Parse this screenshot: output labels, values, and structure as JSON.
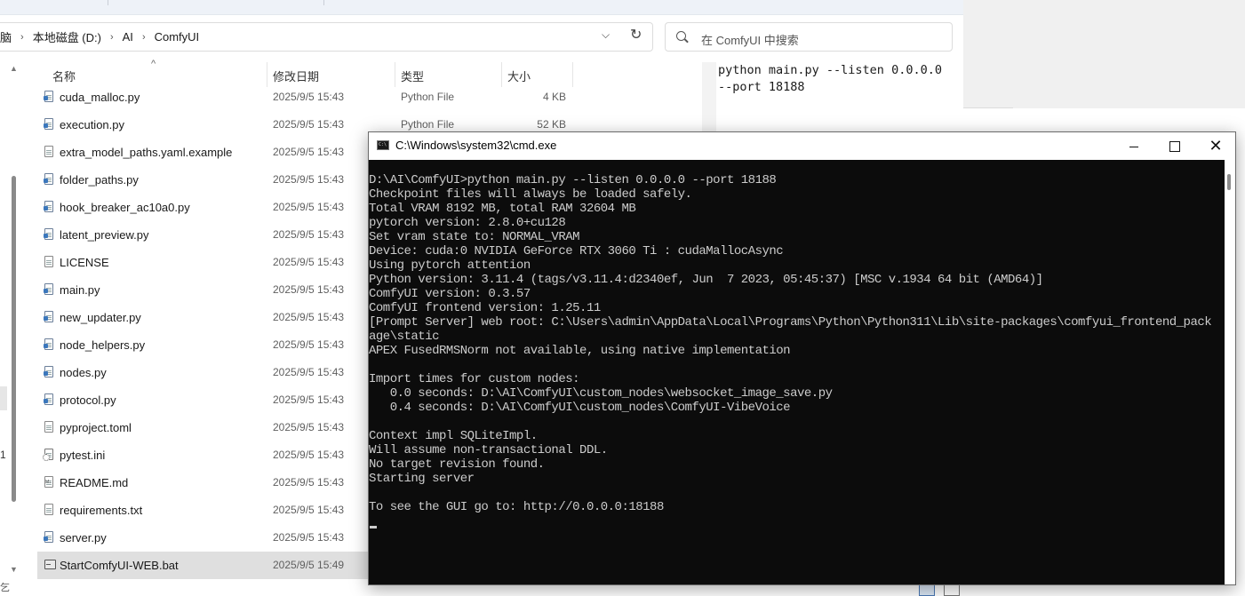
{
  "explorer": {
    "breadcrumbs": [
      "脑",
      "本地磁盘 (D:)",
      "AI",
      "ComfyUI"
    ],
    "search_placeholder": "在 ComfyUI 中搜索",
    "columns": {
      "name": "名称",
      "date": "修改日期",
      "type": "类型",
      "size": "大小"
    },
    "files": [
      {
        "name": "cuda_malloc.py",
        "date": "2025/9/5 15:43",
        "type": "Python File",
        "size": "4 KB",
        "icon": "python-file-icon"
      },
      {
        "name": "execution.py",
        "date": "2025/9/5 15:43",
        "type": "Python File",
        "size": "52 KB",
        "icon": "python-file-icon"
      },
      {
        "name": "extra_model_paths.yaml.example",
        "date": "2025/9/5 15:43",
        "type": "",
        "size": "",
        "icon": "file-icon"
      },
      {
        "name": "folder_paths.py",
        "date": "2025/9/5 15:43",
        "type": "",
        "size": "",
        "icon": "python-file-icon"
      },
      {
        "name": "hook_breaker_ac10a0.py",
        "date": "2025/9/5 15:43",
        "type": "",
        "size": "",
        "icon": "python-file-icon"
      },
      {
        "name": "latent_preview.py",
        "date": "2025/9/5 15:43",
        "type": "",
        "size": "",
        "icon": "python-file-icon"
      },
      {
        "name": "LICENSE",
        "date": "2025/9/5 15:43",
        "type": "",
        "size": "",
        "icon": "file-icon"
      },
      {
        "name": "main.py",
        "date": "2025/9/5 15:43",
        "type": "",
        "size": "",
        "icon": "python-file-icon"
      },
      {
        "name": "new_updater.py",
        "date": "2025/9/5 15:43",
        "type": "",
        "size": "",
        "icon": "python-file-icon"
      },
      {
        "name": "node_helpers.py",
        "date": "2025/9/5 15:43",
        "type": "",
        "size": "",
        "icon": "python-file-icon"
      },
      {
        "name": "nodes.py",
        "date": "2025/9/5 15:43",
        "type": "",
        "size": "",
        "icon": "python-file-icon"
      },
      {
        "name": "protocol.py",
        "date": "2025/9/5 15:43",
        "type": "",
        "size": "",
        "icon": "python-file-icon"
      },
      {
        "name": "pyproject.toml",
        "date": "2025/9/5 15:43",
        "type": "",
        "size": "",
        "icon": "file-icon"
      },
      {
        "name": "pytest.ini",
        "date": "2025/9/5 15:43",
        "type": "",
        "size": "",
        "icon": "settings-file-icon"
      },
      {
        "name": "README.md",
        "date": "2025/9/5 15:43",
        "type": "",
        "size": "",
        "icon": "markdown-file-icon"
      },
      {
        "name": "requirements.txt",
        "date": "2025/9/5 15:43",
        "type": "",
        "size": "",
        "icon": "file-icon"
      },
      {
        "name": "server.py",
        "date": "2025/9/5 15:43",
        "type": "",
        "size": "",
        "icon": "python-file-icon"
      },
      {
        "name": "StartComfyUI-WEB.bat",
        "date": "2025/9/5 15:49",
        "type": "",
        "size": "",
        "icon": "batch-file-icon",
        "selected": true
      }
    ],
    "preview_lines": [
      "python main.py --listen 0.0.0.0",
      "--port 18188"
    ],
    "edge_digit": "1",
    "edge_char": "乞"
  },
  "cmd": {
    "title": "C:\\Windows\\system32\\cmd.exe",
    "lines": [
      "D:\\AI\\ComfyUI>python main.py --listen 0.0.0.0 --port 18188",
      "Checkpoint files will always be loaded safely.",
      "Total VRAM 8192 MB, total RAM 32604 MB",
      "pytorch version: 2.8.0+cu128",
      "Set vram state to: NORMAL_VRAM",
      "Device: cuda:0 NVIDIA GeForce RTX 3060 Ti : cudaMallocAsync",
      "Using pytorch attention",
      "Python version: 3.11.4 (tags/v3.11.4:d2340ef, Jun  7 2023, 05:45:37) [MSC v.1934 64 bit (AMD64)]",
      "ComfyUI version: 0.3.57",
      "ComfyUI frontend version: 1.25.11",
      "[Prompt Server] web root: C:\\Users\\admin\\AppData\\Local\\Programs\\Python\\Python311\\Lib\\site-packages\\comfyui_frontend_pack",
      "age\\static",
      "APEX FusedRMSNorm not available, using native implementation",
      "",
      "Import times for custom nodes:",
      "   0.0 seconds: D:\\AI\\ComfyUI\\custom_nodes\\websocket_image_save.py",
      "   0.4 seconds: D:\\AI\\ComfyUI\\custom_nodes\\ComfyUI-VibeVoice",
      "",
      "Context impl SQLiteImpl.",
      "Will assume non-transactional DDL.",
      "No target revision found.",
      "Starting server",
      "",
      "To see the GUI go to: http://0.0.0.0:18188"
    ]
  }
}
